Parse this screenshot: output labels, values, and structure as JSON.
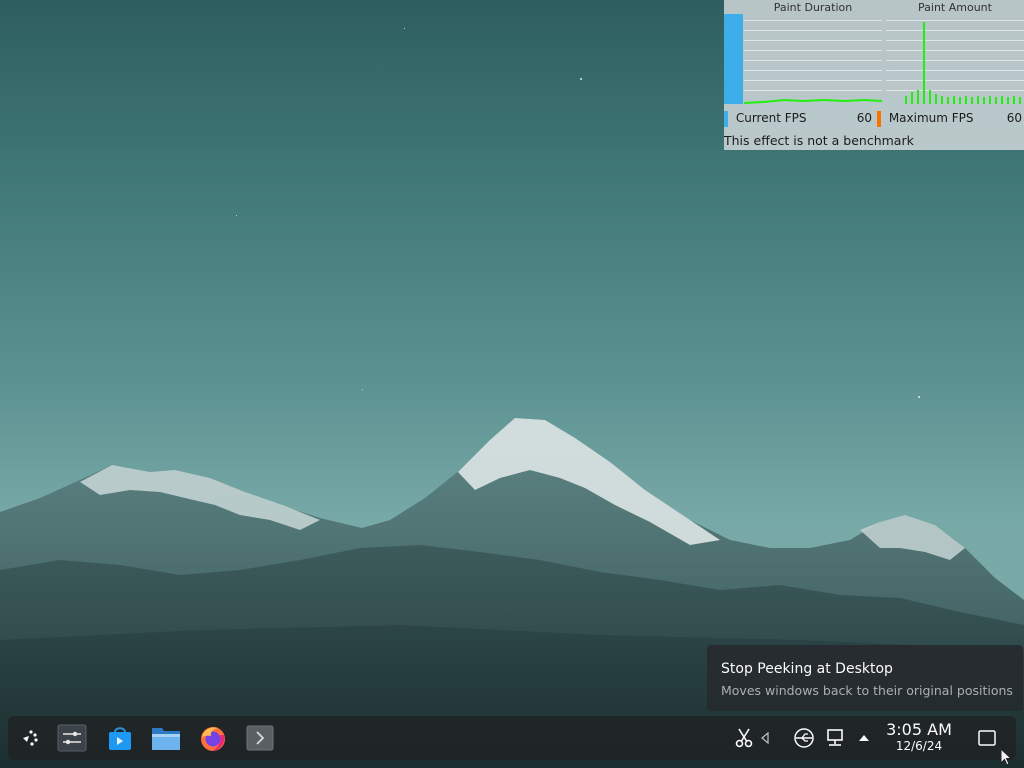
{
  "fps_overlay": {
    "paint_duration_label": "Paint Duration",
    "paint_amount_label": "Paint Amount",
    "current_fps_label": "Current FPS",
    "current_fps_value": "60",
    "maximum_fps_label": "Maximum FPS",
    "maximum_fps_value": "60",
    "footer": "This effect is not a benchmark",
    "colors": {
      "current": "#3daee9",
      "maximum": "#f67400",
      "graph": "#22ee11"
    }
  },
  "tooltip": {
    "title": "Stop Peeking at Desktop",
    "description": "Moves windows back to their original positions"
  },
  "taskbar": {
    "items": [
      {
        "name": "application-launcher-icon"
      },
      {
        "name": "system-settings-icon"
      },
      {
        "name": "discover-store-icon"
      },
      {
        "name": "file-manager-icon"
      },
      {
        "name": "firefox-icon"
      },
      {
        "name": "terminal-icon"
      }
    ]
  },
  "system_tray": {
    "icons": [
      "clipboard-scissors-icon",
      "volume-icon",
      "usb-icon",
      "network-icon",
      "expand-tray-arrow-icon"
    ],
    "clock": {
      "time": "3:05 AM",
      "date": "12/6/24"
    },
    "show_desktop": "peek-at-desktop-icon"
  }
}
